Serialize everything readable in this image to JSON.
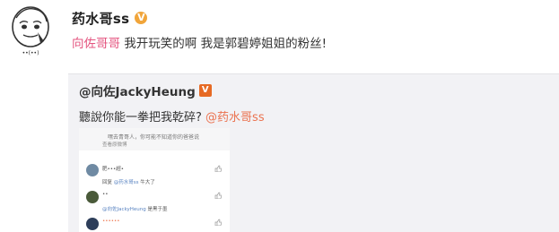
{
  "post": {
    "author_name": "药水哥ss",
    "verified_mark": "V",
    "mention": "向佐哥哥",
    "text": " 我开玩笑的啊 我是郭碧婷姐姐的粉丝!"
  },
  "quoted_post": {
    "author_name": "@向佐JackyHeung",
    "verified_mark": "V",
    "text": "聽說你能一拳把我乾碎?",
    "mention": "@药水哥ss"
  },
  "embedded_screenshot": {
    "header_line": "嘿去青哥人，你可能不知道你的爸爸说",
    "sub_link": "查看原微博",
    "comments": [
      {
        "name": "肥•••超•",
        "time": "",
        "reply_prefix": "回复",
        "reply_mention": "@药水哥ss",
        "reply_text": "牛大了"
      },
      {
        "name": "••",
        "time": "",
        "reply_prefix": "",
        "reply_mention": "@向佐JackyHeung",
        "reply_text": "是黑于墨"
      },
      {
        "name": "••••••",
        "time": "",
        "reply_prefix": "",
        "reply_mention": "",
        "reply_text": ""
      }
    ]
  }
}
